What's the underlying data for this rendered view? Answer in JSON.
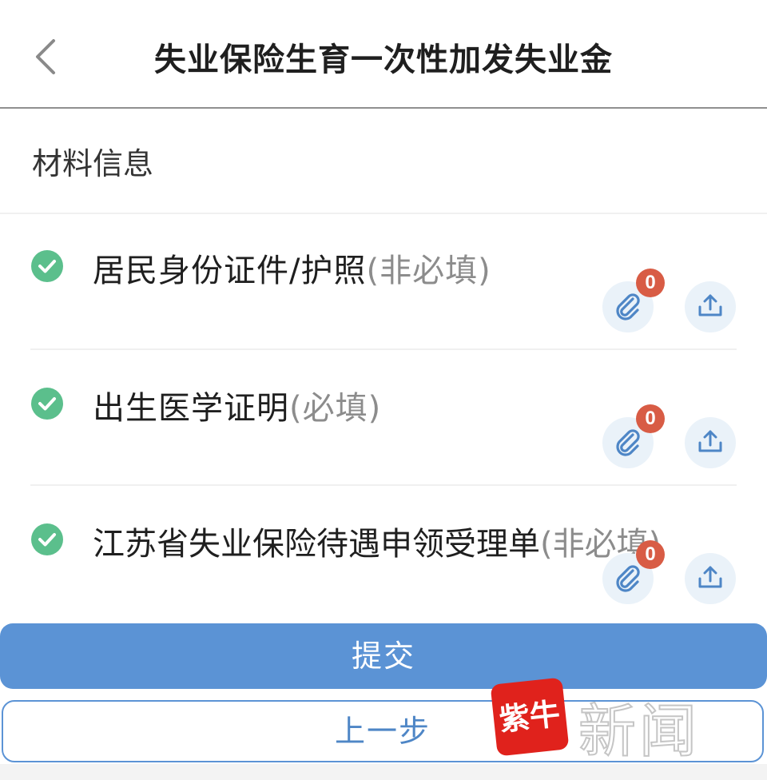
{
  "header": {
    "title": "失业保险生育一次性加发失业金",
    "back_icon": "chevron-left-icon"
  },
  "section": {
    "title": "材料信息"
  },
  "materials": [
    {
      "name": "居民身份证件/护照",
      "requirement": "(非必填)",
      "attachment_count": "0",
      "status_icon": "check-circle-icon"
    },
    {
      "name": "出生医学证明",
      "requirement": "(必填)",
      "attachment_count": "0",
      "status_icon": "check-circle-icon"
    },
    {
      "name": "江苏省失业保险待遇申领受理单",
      "requirement": "(非必填)",
      "attachment_count": "0",
      "status_icon": "check-circle-icon"
    }
  ],
  "actions": {
    "submit_label": "提交",
    "prev_label": "上一步"
  },
  "watermark": {
    "logo_text": "紫牛",
    "text": "新闻"
  },
  "colors": {
    "primary": "#5b93d5",
    "check_green": "#5bbf8c",
    "badge_red": "#d85c45",
    "icon_blue": "#4e86c6",
    "icon_bg": "#eaf2f9"
  }
}
